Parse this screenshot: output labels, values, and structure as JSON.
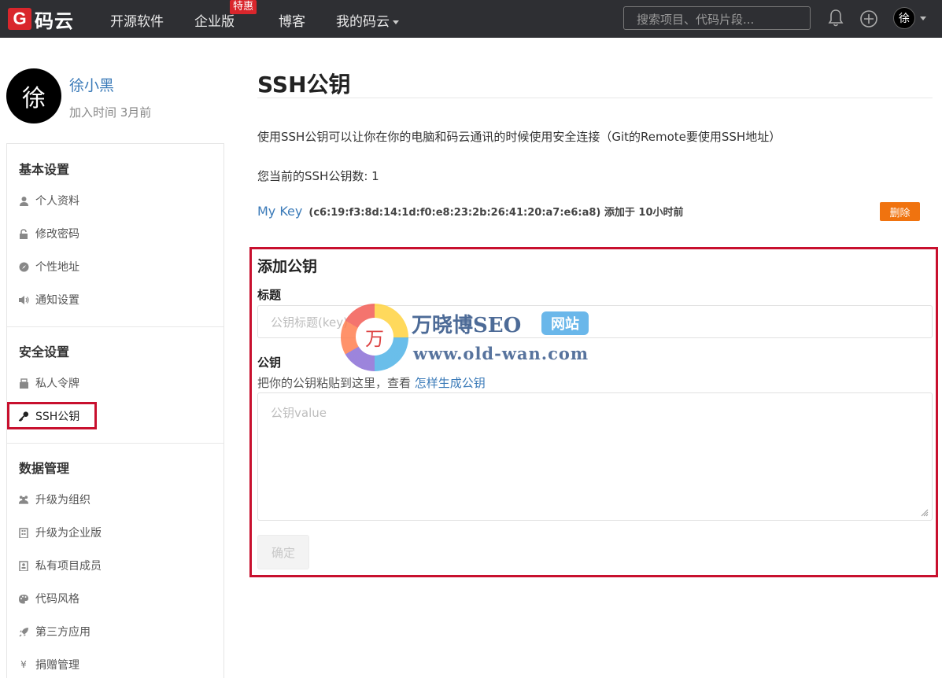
{
  "header": {
    "logo_mark": "G",
    "logo_text": "码云",
    "nav": [
      "开源软件",
      "企业版",
      "博客",
      "我的码云"
    ],
    "badge": "特惠",
    "search_placeholder": "搜索项目、代码片段...",
    "avatar_char": "徐"
  },
  "profile": {
    "avatar_char": "徐",
    "name": "徐小黑",
    "joined": "加入时间 3月前"
  },
  "sidebar": {
    "groups": [
      {
        "title": "基本设置",
        "items": [
          "个人资料",
          "修改密码",
          "个性地址",
          "通知设置"
        ]
      },
      {
        "title": "安全设置",
        "items": [
          "私人令牌",
          "SSH公钥"
        ]
      },
      {
        "title": "数据管理",
        "items": [
          "升级为组织",
          "升级为企业版",
          "私有项目成员",
          "代码风格",
          "第三方应用",
          "捐赠管理"
        ]
      }
    ]
  },
  "main": {
    "title": "SSH公钥",
    "description": "使用SSH公钥可以让你在你的电脑和码云通讯的时候使用安全连接（Git的Remote要使用SSH地址）",
    "count_text": "您当前的SSH公钥数: 1",
    "key": {
      "name": "My Key",
      "fingerprint": "(c6:19:f3:8d:14:1d:f0:e8:23:2b:26:41:20:a7:e6:a8) 添加于 10小时前",
      "delete_label": "删除"
    },
    "form": {
      "title": "添加公钥",
      "title_label": "标题",
      "title_placeholder": "公钥标题(key)",
      "key_label": "公钥",
      "hint": "把你的公钥粘贴到这里，查看 ",
      "hint_link": "怎样生成公钥",
      "key_placeholder": "公钥value",
      "submit_label": "确定"
    }
  },
  "watermark": {
    "glyph": "万",
    "title": "万晓博SEO",
    "tag": "网站",
    "url": "www.old-wan.com"
  },
  "colors": {
    "topbar": "#2e2f33",
    "brand_red": "#d9262c",
    "link_blue": "#3a7ab8",
    "delete_orange": "#f0730f",
    "highlight_red": "#c8102e"
  }
}
